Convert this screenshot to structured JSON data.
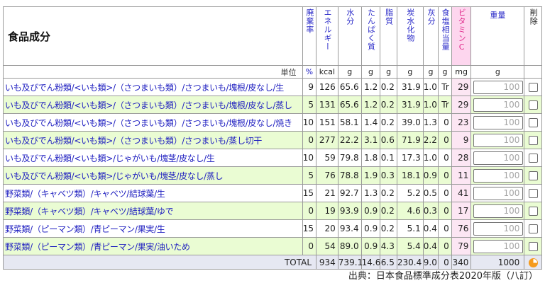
{
  "header": {
    "title": "食品成分",
    "columns": [
      {
        "key": "refuse",
        "label": "廃棄率",
        "vertical": true
      },
      {
        "key": "energy",
        "label": "エネルギー",
        "vertical": true
      },
      {
        "key": "water",
        "label": "水分",
        "vertical": true
      },
      {
        "key": "protein",
        "label": "たんぱく質",
        "vertical": true
      },
      {
        "key": "fat",
        "label": "脂質",
        "vertical": true
      },
      {
        "key": "carb",
        "label": "炭水化物",
        "vertical": true
      },
      {
        "key": "ash",
        "label": "灰分",
        "vertical": true
      },
      {
        "key": "salt",
        "label": "食塩相当量",
        "vertical": true
      },
      {
        "key": "vitc",
        "label": "ビタミンC",
        "vertical": true
      },
      {
        "key": "weight",
        "label": "重量",
        "vertical": false
      },
      {
        "key": "delete",
        "label": "削除",
        "vertical": true
      }
    ]
  },
  "units": {
    "label": "単位",
    "refuse": "%",
    "energy": "kcal",
    "water": "g",
    "protein": "g",
    "fat": "g",
    "carb": "g",
    "ash": "g",
    "salt": "g",
    "vitc": "mg",
    "weight": "g"
  },
  "rows": [
    {
      "name": "いも及びでん粉類/<いも類>/（さつまいも類）/さつまいも/塊根/皮なし/生",
      "refuse": "9",
      "energy": "126",
      "water": "65.6",
      "protein": "1.2",
      "fat": "0.2",
      "carb": "31.9",
      "ash": "1.0",
      "salt": "Tr",
      "vitc": "29",
      "weight": "100"
    },
    {
      "name": "いも及びでん粉類/<いも類>/（さつまいも類）/さつまいも/塊根/皮なし/蒸し",
      "refuse": "5",
      "energy": "131",
      "water": "65.6",
      "protein": "1.2",
      "fat": "0.2",
      "carb": "31.9",
      "ash": "1.0",
      "salt": "Tr",
      "vitc": "29",
      "weight": "100"
    },
    {
      "name": "いも及びでん粉類/<いも類>/（さつまいも類）/さつまいも/塊根/皮なし/焼き",
      "refuse": "10",
      "energy": "151",
      "water": "58.1",
      "protein": "1.4",
      "fat": "0.2",
      "carb": "39.0",
      "ash": "1.3",
      "salt": "0",
      "vitc": "23",
      "weight": "100"
    },
    {
      "name": "いも及びでん粉類/<いも類>/（さつまいも類）/さつまいも/蒸し切干",
      "refuse": "0",
      "energy": "277",
      "water": "22.2",
      "protein": "3.1",
      "fat": "0.6",
      "carb": "71.9",
      "ash": "2.2",
      "salt": "0",
      "vitc": "9",
      "weight": "100"
    },
    {
      "name": "いも及びでん粉類/<いも類>/じゃがいも/塊茎/皮なし/生",
      "refuse": "10",
      "energy": "59",
      "water": "79.8",
      "protein": "1.8",
      "fat": "0.1",
      "carb": "17.3",
      "ash": "1.0",
      "salt": "0",
      "vitc": "28",
      "weight": "100"
    },
    {
      "name": "いも及びでん粉類/<いも類>/じゃがいも/塊茎/皮なし/蒸し",
      "refuse": "5",
      "energy": "76",
      "water": "78.8",
      "protein": "1.9",
      "fat": "0.3",
      "carb": "18.1",
      "ash": "0.9",
      "salt": "0",
      "vitc": "11",
      "weight": "100"
    },
    {
      "name": "野菜類/（キャベツ類）/キャベツ/結球葉/生",
      "refuse": "15",
      "energy": "21",
      "water": "92.7",
      "protein": "1.3",
      "fat": "0.2",
      "carb": "5.2",
      "ash": "0.5",
      "salt": "0",
      "vitc": "41",
      "weight": "100"
    },
    {
      "name": "野菜類/（キャベツ類）/キャベツ/結球葉/ゆで",
      "refuse": "0",
      "energy": "19",
      "water": "93.9",
      "protein": "0.9",
      "fat": "0.2",
      "carb": "4.6",
      "ash": "0.3",
      "salt": "0",
      "vitc": "17",
      "weight": "100"
    },
    {
      "name": "野菜類/（ピーマン類）/青ピーマン/果実/生",
      "refuse": "15",
      "energy": "20",
      "water": "93.4",
      "protein": "0.9",
      "fat": "0.2",
      "carb": "5.1",
      "ash": "0.4",
      "salt": "0",
      "vitc": "76",
      "weight": "100"
    },
    {
      "name": "野菜類/（ピーマン類）/青ピーマン/果実/油いため",
      "refuse": "0",
      "energy": "54",
      "water": "89.0",
      "protein": "0.9",
      "fat": "4.3",
      "carb": "5.4",
      "ash": "0.4",
      "salt": "0",
      "vitc": "79",
      "weight": "100"
    }
  ],
  "total": {
    "label": "TOTAL",
    "energy": "934",
    "water": "739.1",
    "protein": "14.6",
    "fat": "6.5",
    "carb": "230.4",
    "ash": "9.0",
    "salt": "0",
    "vitc": "340",
    "weight": "1000",
    "icon": "pie-chart-icon",
    "icon_color": "#f59a1c"
  },
  "source": "出典：日本食品標準成分表2020年版（八訂）",
  "colors": {
    "name_text": "#1e1ec0",
    "header_text": "#2a2ac8",
    "row_alt": "#eafcd3",
    "vitc_header": "#fdd6ee",
    "total_row": "#e6e8f2"
  }
}
